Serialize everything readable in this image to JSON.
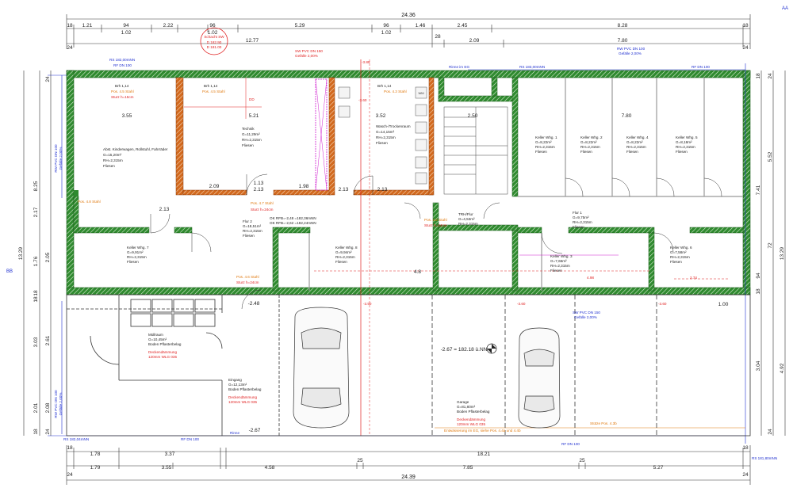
{
  "colors": {
    "wall_green": "#2f8a2f",
    "wall_orange": "#d2691e",
    "dim_line": "#333333",
    "red": "#e02020",
    "blue": "#2030d0",
    "magenta": "#d020d0"
  },
  "top_dims": {
    "overall": "24.36",
    "row1": [
      "1.21",
      "94",
      "2.22",
      "96",
      "5.29",
      "96",
      "1.46",
      "2.45",
      "8.28"
    ],
    "row1_sub": [
      "1.02",
      "1.02",
      "1.02"
    ],
    "row1_edge": [
      "18",
      "18"
    ],
    "row2": [
      "12.77",
      "28",
      "2.09",
      "7.80"
    ],
    "row2_edge": [
      "24",
      "24"
    ]
  },
  "bottom_dims": {
    "overall": "24.39",
    "row1": [
      "1.78",
      "3.37",
      "18.21"
    ],
    "row1_edge": [
      "18",
      "18"
    ],
    "row2": [
      "1.79",
      "3.55",
      "4.58",
      "25",
      "7.85",
      "25",
      "5.27"
    ],
    "row2_edge": [
      "24",
      "24"
    ]
  },
  "left_dims": [
    "8.25",
    "2.17",
    "13.29",
    "24",
    "2.05",
    "1.76",
    "18",
    "3.03",
    "2.61",
    "18",
    "2.01",
    "2.08",
    "24",
    "18"
  ],
  "right_dims": [
    "5.52",
    "7.41",
    "13.29",
    "72",
    "94",
    "4.92",
    "3.04",
    "18",
    "24",
    "24",
    "18"
  ],
  "inner_dims": [
    "3.55",
    "5.21",
    "3.52",
    "2.50",
    "7.80",
    "1.13",
    "1.98",
    "2.09",
    "2.13",
    "2.13",
    "2.13",
    "2.13",
    "1.00",
    "-2.48",
    "-2.67",
    "-2.67 = 182.18 ü.NN",
    "-3.89",
    "-3.50",
    "-3.60",
    "-3.60",
    "-3.60",
    "4.98",
    "2.74",
    "4.8"
  ],
  "rooms": [
    {
      "name": "Abst. Kinderwagen, Rollstuhl, Fahrräder",
      "area": "G=15,20m²",
      "height": "RH=2,315m",
      "floor": "Fliesen"
    },
    {
      "name": "Technik",
      "area": "G=11,29m²",
      "height": "RH=2,315m",
      "floor": "Fliesen"
    },
    {
      "name": "Wasch-/Trockenraum",
      "area": "G=14,15m²",
      "height": "RH=2,315m",
      "floor": "Fliesen"
    },
    {
      "name": "Keller Whg. 1",
      "area": "G=8,22m²",
      "height": "RH=2,315m",
      "floor": "Fliesen"
    },
    {
      "name": "Keller Whg. 2",
      "area": "G=8,22m²",
      "height": "RH=2,315m",
      "floor": "Fliesen"
    },
    {
      "name": "Keller Whg. 4",
      "area": "G=8,22m²",
      "height": "RH=2,315m",
      "floor": "Fliesen"
    },
    {
      "name": "Keller Whg. 5",
      "area": "G=8,18m²",
      "height": "RH=2,315m",
      "floor": "Fliesen"
    },
    {
      "name": "Flur 2",
      "area": "G=18,51m²",
      "height": "RH=2,315m",
      "floor": "Fliesen"
    },
    {
      "name": "Keller Whg. 7",
      "area": "G=9,91m²",
      "height": "RH=2,315m",
      "floor": "Fliesen"
    },
    {
      "name": "Keller Whg. 8",
      "area": "G=9,94m²",
      "height": "RH=2,315m",
      "floor": "Fliesen"
    },
    {
      "name": "TRH/Flur",
      "area": "G=4,53m²",
      "height": "RH=2,315m",
      "floor": ""
    },
    {
      "name": "Flur 1",
      "area": "G=9,75m²",
      "height": "RH=2,315m",
      "floor": "Fliesen"
    },
    {
      "name": "Keller Whg. 3",
      "area": "G=7,66m²",
      "height": "RH=2,315m",
      "floor": "Fliesen"
    },
    {
      "name": "Keller Whg. 6",
      "area": "G=7,58m²",
      "height": "RH=2,315m",
      "floor": "Fliesen"
    },
    {
      "name": "Müllraum",
      "area": "G=10,45m²",
      "height": "",
      "floor": "Boden Pflasterbelag"
    },
    {
      "name": "Eingang",
      "area": "G=12,13m²",
      "height": "",
      "floor": "Boden Pflasterbelag"
    },
    {
      "name": "Garage",
      "area": "G=81,80m²",
      "height": "",
      "floor": "Boden Pflasterbelag"
    }
  ],
  "annotations": {
    "insulation_1": "Deckendämmung",
    "insulation_1b": "120mm WLG 035",
    "insulation_2": "Deckendämmung",
    "insulation_2b": "120mm WLG 035",
    "insulation_3": "Deckendämmung",
    "insulation_3b": "120mm WLG 035",
    "fire_label": "Brh 1,14",
    "fire_label2": "Brh 1,14",
    "fire_label3": "Brh 1,14",
    "pos1": "Pos. 4.5 Stahl",
    "pos2": "Pos. 4.5 Stahl",
    "pos3": "Pos. 4.3 Stahl",
    "pos4": "Pos. 4.8 Stahl",
    "pos5": "Pos. 4.7 Stahl",
    "pos6": "Pos. 4.6 Stahl",
    "pos7": "Pos. 4.2 Stahl",
    "sturz1": "Sturz h=15cm",
    "sturz2": "Sturz h=24cm",
    "sturz3": "Sturz h=24cm",
    "sturz4": "Sturz h=24cm",
    "schacht": "Schacht SW",
    "schacht_vals": "D 182.90",
    "schacht_vals2": "D 181.00",
    "pipe_top1": "RW PVC DN 100",
    "pipe_top1b": "Gefälle 2,00%",
    "pipe_top2": "SW PVC DN 150",
    "pipe_top2b": "Gefälle 2,00%",
    "pipe_left": "RW PVC DN 100",
    "pipe_leftb": "Gefälle 2,00%",
    "pipe_left2": "RW PVC DN 100",
    "pipe_left2b": "Gefälle 2,00%",
    "pipe_mid": "SW PVC DN 150",
    "pipe_midb": "Gefälle 2,00%",
    "rs_tl": "RS 182,00mNN",
    "rf_tl": "RF DN 100",
    "rs_tr": "RS 183,00mNN",
    "rf_tr": "RF DN 100",
    "rs_bl": "RS 182,04mNN",
    "rf_bl": "RF DN 100",
    "rs_br": "RS 181,80mNN",
    "rf_br": "RF DN 100",
    "rinne_top": "Rinne im EG",
    "rinne_bottom": "Rinne",
    "ok_rfb": "OK RFB=-2,48 =182,36mNN",
    "ok_rfb2": "OK RFB=-2,62 =182,24mNN",
    "wm": "WM",
    "bb": "BB",
    "aa": "AA",
    "od": "DD",
    "stuetze": "Stütze Pos. 4.3b",
    "entwaesserung": "Entwässerung im EG, siehe Pos. 4.4a und 4.4b"
  }
}
